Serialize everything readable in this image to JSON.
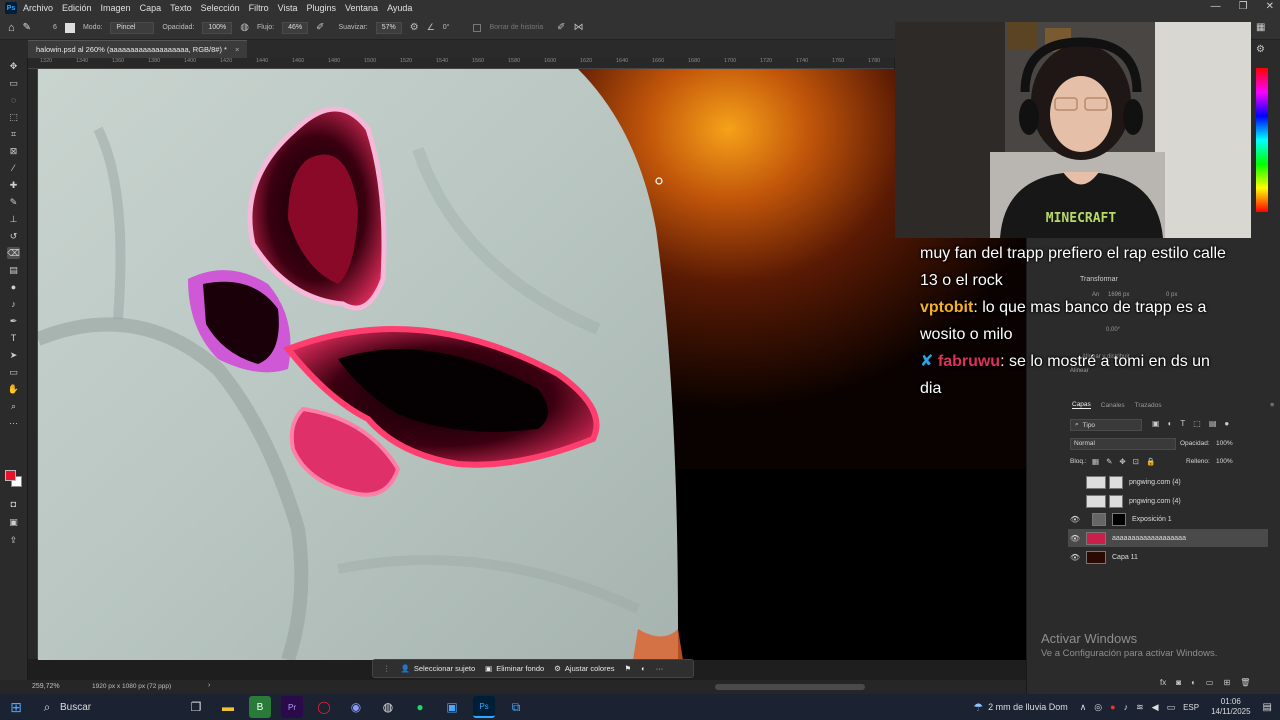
{
  "app": {
    "logo": "Ps",
    "menu": [
      "Archivo",
      "Edición",
      "Imagen",
      "Capa",
      "Texto",
      "Selección",
      "Filtro",
      "Vista",
      "Plugins",
      "Ventana",
      "Ayuda"
    ]
  },
  "options_bar": {
    "mode_label": "Modo:",
    "mode_value": "Pincel",
    "opacity_label": "Opacidad:",
    "opacity_value": "100%",
    "flow_label": "Flujo:",
    "flow_value": "46%",
    "smooth_label": "Suavizar:",
    "smooth_value": "57%",
    "angle_value": "0°",
    "history_label": "Borrar de historia",
    "brush_size": "6"
  },
  "document": {
    "tab_title": "halowin.psd al 260% (aaaaaaaaaaaaaaaaaaa, RGB/8#) *",
    "close_label": "×"
  },
  "ruler": {
    "ticks": [
      "1320",
      "1340",
      "1360",
      "1380",
      "1400",
      "1420",
      "1440",
      "1460",
      "1480",
      "1500",
      "1520",
      "1540",
      "1560",
      "1580",
      "1600",
      "1620",
      "1640",
      "1660",
      "1680",
      "1700",
      "1720",
      "1740",
      "1760",
      "1780"
    ]
  },
  "context_bar": {
    "select_subject": "Seleccionar sujeto",
    "remove_bg": "Eliminar fondo",
    "adjust_colors": "Ajustar colores"
  },
  "status": {
    "zoom": "259,72%",
    "doc_info": "1920 px x 1080 px (72 ppp)"
  },
  "chat": {
    "line1": "muy fan del trapp prefiero el rap estilo calle 13 o el rock",
    "user2": "vptobit",
    "msg2": ": lo que mas banco de trapp es a wosito o milo",
    "badge3": "✘",
    "user3": "fabruwu",
    "msg3": ": se lo mostré a tomi en ds un dia"
  },
  "properties": {
    "header": "Transformar",
    "an": "An",
    "an_value": "1696 px",
    "x_value": "0 px",
    "angle": "0,00°",
    "align": "Alinear y distribuir",
    "align2": "Alinear"
  },
  "layers_panel": {
    "tabs": [
      "Capas",
      "Canales",
      "Trazados"
    ],
    "filter_label": "Tipo",
    "blend_mode": "Normal",
    "opacity_label": "Opacidad:",
    "opacity_value": "100%",
    "lock_label": "Bloq.:",
    "fill_label": "Relleno:",
    "fill_value": "100%",
    "layers": [
      {
        "name": "pngwing.com (4)"
      },
      {
        "name": "pngwing.com (4)"
      },
      {
        "name": "Exposición 1"
      },
      {
        "name": "aaaaaaaaaaaaaaaaaaa"
      },
      {
        "name": "Capa 11"
      }
    ]
  },
  "activate_windows": {
    "title": "Activar Windows",
    "subtitle": "Ve a Configuración para activar Windows."
  },
  "taskbar": {
    "search": "Buscar",
    "weather": "2 mm de lluvia Dom",
    "lang": "ESP",
    "time": "01:06",
    "date": "14/11/2025"
  },
  "webcam": {
    "shirt_text": "MINECRAFT"
  },
  "colors": {
    "accent": "#31a8ff",
    "foreground": "#e8122a",
    "background": "#ffffff"
  }
}
